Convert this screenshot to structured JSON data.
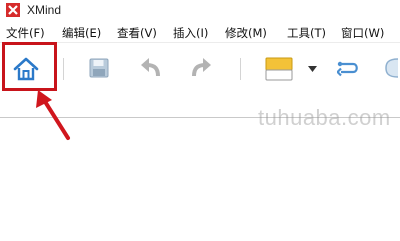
{
  "app": {
    "title": "XMind"
  },
  "menu": {
    "items": [
      {
        "label": "文件(F)"
      },
      {
        "label": "编辑(E)"
      },
      {
        "label": "查看(V)"
      },
      {
        "label": "插入(I)"
      },
      {
        "label": "修改(M)"
      },
      {
        "label": "工具(T)"
      },
      {
        "label": "窗口(W)"
      }
    ]
  },
  "toolbar": {
    "icons": [
      "home-icon",
      "save-icon",
      "undo-icon",
      "redo-icon",
      "fill-color-icon",
      "dropdown-arrow-icon",
      "relationship-icon",
      "boundary-icon"
    ]
  },
  "colors": {
    "highlight": "#c8141b",
    "home_icon": "#2b79c9",
    "logo": "#d62b2b"
  },
  "watermark": {
    "text": "tuhuaba.com"
  }
}
